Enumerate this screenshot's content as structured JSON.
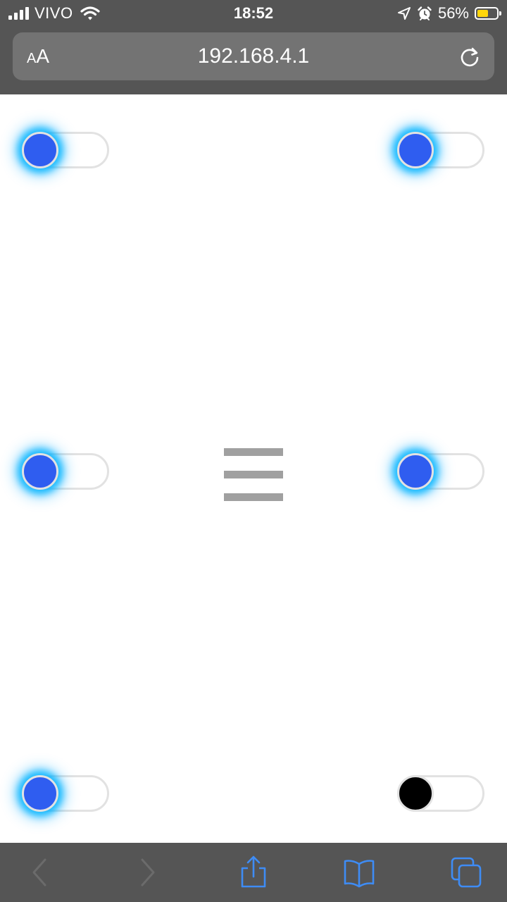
{
  "status_bar": {
    "carrier": "VIVO",
    "time": "18:52",
    "battery_percent": "56%",
    "battery_level": 0.56,
    "icons": [
      "signal-icon",
      "wifi-icon",
      "location-arrow-icon",
      "alarm-icon",
      "battery-icon"
    ]
  },
  "browser": {
    "text_size_button": "AA",
    "url": "192.168.4.1",
    "icons": [
      "reload-icon",
      "back-icon",
      "forward-icon",
      "share-icon",
      "bookmarks-icon",
      "tabs-icon"
    ]
  },
  "page": {
    "toggles": [
      {
        "id": "top-left",
        "state": "on"
      },
      {
        "id": "top-right",
        "state": "on"
      },
      {
        "id": "middle-left",
        "state": "on"
      },
      {
        "id": "middle-right",
        "state": "on"
      },
      {
        "id": "bottom-left",
        "state": "on"
      },
      {
        "id": "bottom-right",
        "state": "off"
      }
    ],
    "menu_icon": "hamburger-menu-icon",
    "colors": {
      "knob_on": "#2f5df0",
      "glow": "#00b4ff",
      "knob_off": "#000000",
      "track_border": "#e2e2e2",
      "menu_bars": "#a0a0a0"
    }
  }
}
